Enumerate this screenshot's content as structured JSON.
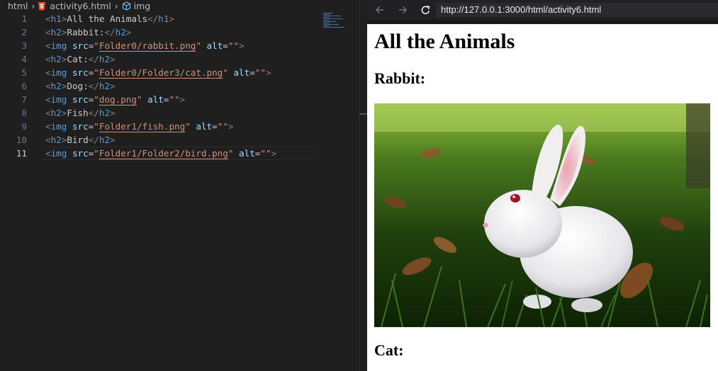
{
  "editor": {
    "breadcrumb": {
      "folder": "html",
      "file": "activity6.html",
      "symbol": "img"
    },
    "current_line": 11,
    "lines": [
      {
        "n": "1",
        "code": "<h1>All the Animals</h1>"
      },
      {
        "n": "2",
        "code": "<h2>Rabbit:</h2>"
      },
      {
        "n": "3",
        "code": "<img src=\"Folder0/rabbit.png\" alt=\"\">"
      },
      {
        "n": "4",
        "code": "<h2>Cat:</h2>"
      },
      {
        "n": "5",
        "code": "<img src=\"Folder0/Folder3/cat.png\" alt=\"\">"
      },
      {
        "n": "6",
        "code": "<h2>Dog:</h2>"
      },
      {
        "n": "7",
        "code": "<img src=\"dog.png\" alt=\"\">"
      },
      {
        "n": "8",
        "code": "<h2>Fish</h2>"
      },
      {
        "n": "9",
        "code": "<img src=\"Folder1/fish.png\" alt=\"\">"
      },
      {
        "n": "10",
        "code": "<h2>Bird</h2>"
      },
      {
        "n": "11",
        "code": "<img src=\"Folder1/Folder2/bird.png\" alt=\"\">"
      }
    ]
  },
  "browser": {
    "url": "http://127.0.0.1:3000/html/activity6.html",
    "icons": [
      "back-arrow-icon",
      "forward-arrow-icon",
      "reload-icon"
    ],
    "page": {
      "h1": "All the Animals",
      "h2_rabbit": "Rabbit:",
      "h2_cat": "Cat:",
      "image": "rabbit-photo"
    }
  },
  "colors": {
    "editor_bg": "#1f1f1f",
    "tag_name": "#569cd6",
    "attr_name": "#9cdcfe",
    "string": "#ce9178",
    "browser_bar": "#202124"
  }
}
